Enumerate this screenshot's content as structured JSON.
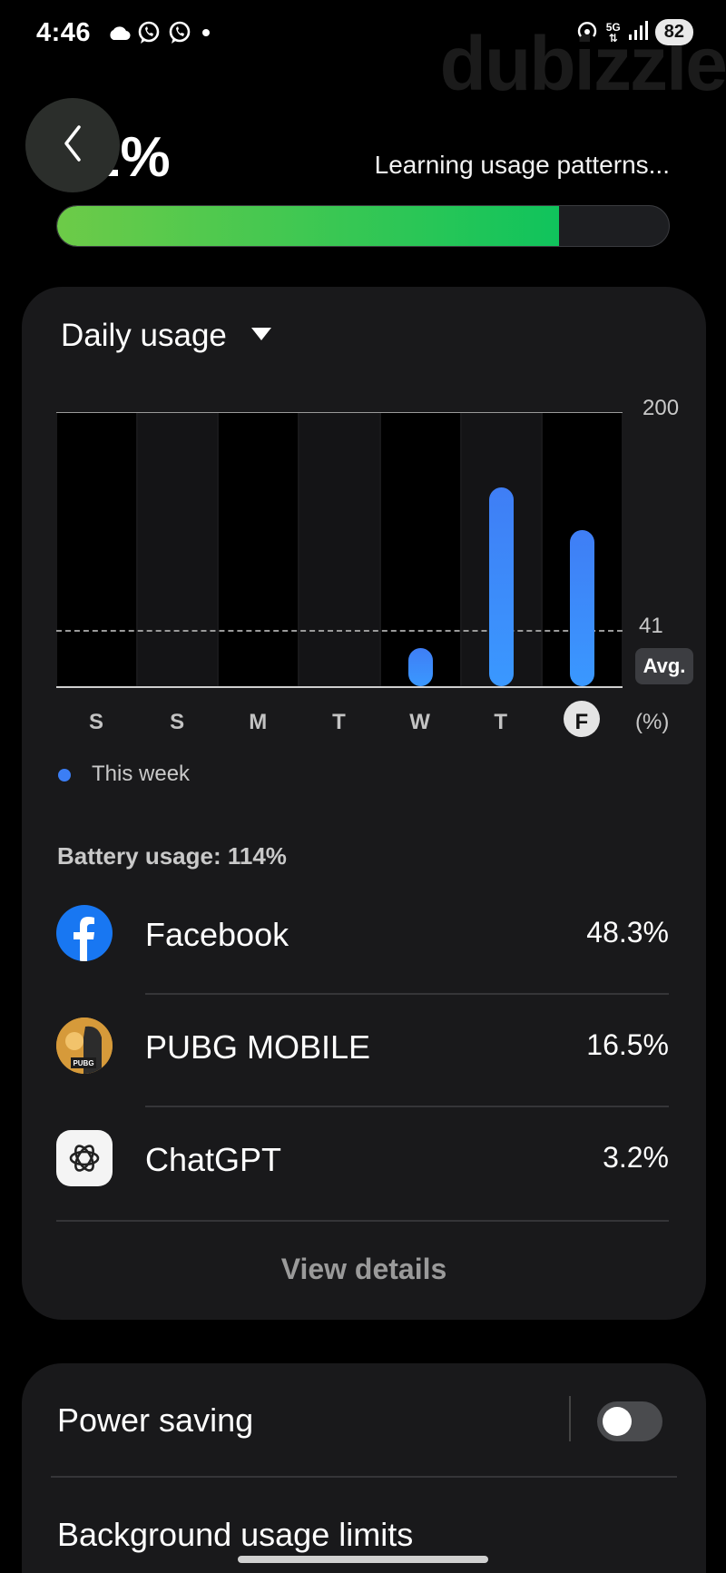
{
  "status_bar": {
    "time": "4:46",
    "left_icons": [
      "cloud-icon",
      "whatsapp-icon",
      "whatsapp-icon",
      "dot-icon"
    ],
    "network": "5G",
    "battery": "82"
  },
  "watermark": "dubizzle",
  "header": {
    "percent": "2%",
    "learning": "Learning usage patterns...",
    "progress": 0.82
  },
  "usage_card": {
    "title": "Daily usage",
    "legend": "This week",
    "battery_usage": "Battery usage: 114%",
    "view_details": "View details",
    "apps": [
      {
        "name": "Facebook",
        "pct": "48.3%",
        "icon": "facebook-icon"
      },
      {
        "name": "PUBG MOBILE",
        "pct": "16.5%",
        "icon": "pubg-icon"
      },
      {
        "name": "ChatGPT",
        "pct": "3.2%",
        "icon": "chatgpt-icon"
      }
    ]
  },
  "chart_data": {
    "type": "bar",
    "categories": [
      "S",
      "S",
      "M",
      "T",
      "W",
      "T",
      "F"
    ],
    "values": [
      0,
      0,
      0,
      0,
      28,
      145,
      114
    ],
    "ylim": [
      0,
      200
    ],
    "y_ticks": [
      "200",
      "41"
    ],
    "y_unit": "(%)",
    "average": 41,
    "average_label": "Avg.",
    "highlight": "F",
    "series": [
      {
        "name": "This week",
        "color": "#3b7ef5"
      }
    ]
  },
  "settings": {
    "power_saving": "Power saving",
    "power_saving_on": false,
    "background_limits": "Background usage limits"
  }
}
